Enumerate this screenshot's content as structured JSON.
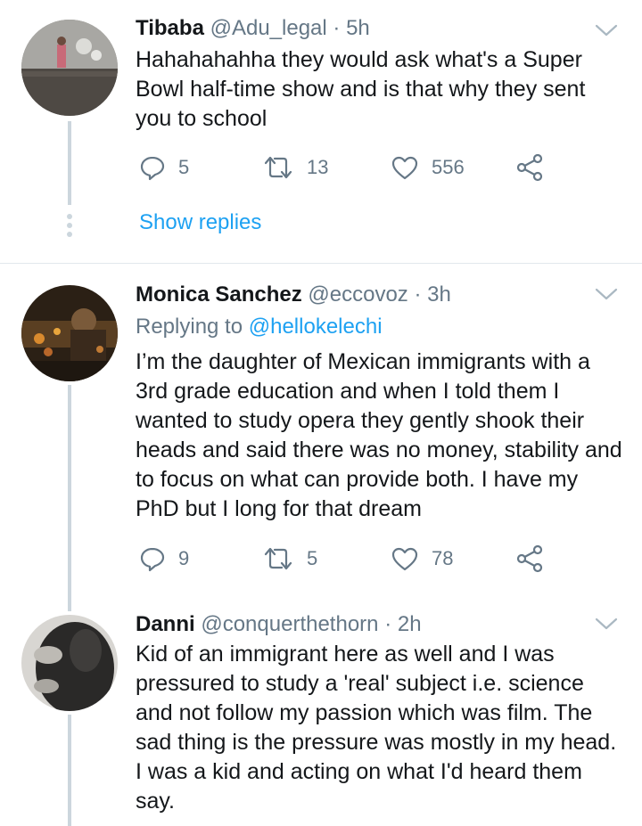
{
  "tweets": [
    {
      "name": "Tibaba",
      "handle": "@Adu_legal",
      "dot": "·",
      "time": "5h",
      "body": "Hahahahahha they would ask what's a Super\nBowl half-time  show and is that why they sent\nyou to school",
      "replies": "5",
      "retweets": "13",
      "likes": "556",
      "show_replies": "Show replies"
    },
    {
      "name": "Monica Sanchez",
      "handle": "@eccovoz",
      "dot": "·",
      "time": "3h",
      "replying_to_label": "Replying to",
      "replying_to_handle": "@hellokelechi",
      "body": "I’m the daughter of Mexican immigrants with a\n3rd grade education and when I told them I\nwanted to study opera they gently shook their\nheads and said there was no money, stability and\nto focus on what can provide both. I have my\nPhD but I long for that dream",
      "replies": "9",
      "retweets": "5",
      "likes": "78"
    },
    {
      "name": "Danni",
      "handle": "@conquerthethorn",
      "dot": "·",
      "time": "2h",
      "body": "Kid of an immigrant here as well and I was\npressured to study a 'real' subject i.e. science\nand not follow my passion which was film. The\nsad thing is the pressure was mostly in my head.\nI was a kid and acting on what I'd heard them\nsay."
    }
  ],
  "icons": {
    "reply": "reply-icon",
    "retweet": "retweet-icon",
    "like": "heart-icon",
    "share": "share-icon",
    "menu": "chevron-down-icon"
  },
  "colors": {
    "link": "#1da1f2",
    "secondary": "#657786",
    "thread_line": "#ccd6dd"
  }
}
